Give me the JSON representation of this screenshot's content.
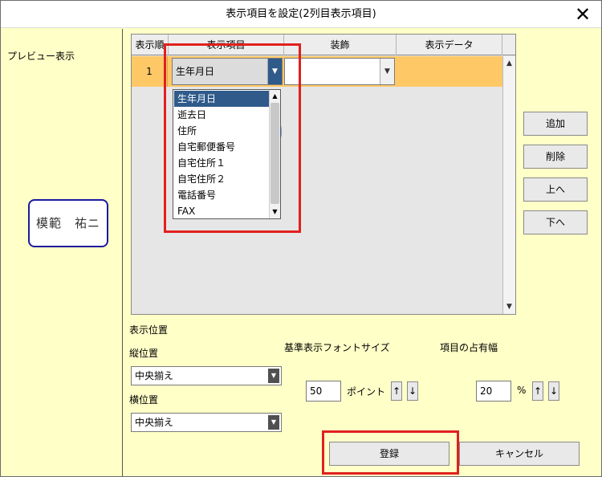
{
  "window": {
    "title": "表示項目を設定(2列目表示項目)",
    "close_icon": "close-icon"
  },
  "left": {
    "preview_label": "プレビュー表示",
    "seal_text": "模範　祐ニ"
  },
  "grid": {
    "headers": [
      "表示順",
      "表示項目",
      "装飾",
      "表示データ"
    ],
    "rows": [
      {
        "order": "1",
        "item": "生年月日",
        "decoration": "",
        "data": ""
      }
    ]
  },
  "dropdown": {
    "items": [
      "生年月日",
      "逝去日",
      "住所",
      "自宅郵便番号",
      "自宅住所１",
      "自宅住所２",
      "電話番号",
      "FAX"
    ],
    "selected_index": 0
  },
  "side_buttons": {
    "add": "追加",
    "delete": "削除",
    "up": "上へ",
    "down": "下へ"
  },
  "position": {
    "heading": "表示位置",
    "vertical_label": "縦位置",
    "vertical_value": "中央揃え",
    "horizontal_label": "横位置",
    "horizontal_value": "中央揃え"
  },
  "font_size": {
    "label": "基準表示フォントサイズ",
    "value": "50",
    "unit": "ポイント"
  },
  "width": {
    "label": "項目の占有幅",
    "value": "20",
    "unit": "%"
  },
  "buttons": {
    "register": "登録",
    "cancel": "キャンセル"
  },
  "colors": {
    "highlight": "#e0201e",
    "row_selected": "#ffc867",
    "window_bg": "#ffffc8",
    "seal_border": "#1a1aa0"
  }
}
